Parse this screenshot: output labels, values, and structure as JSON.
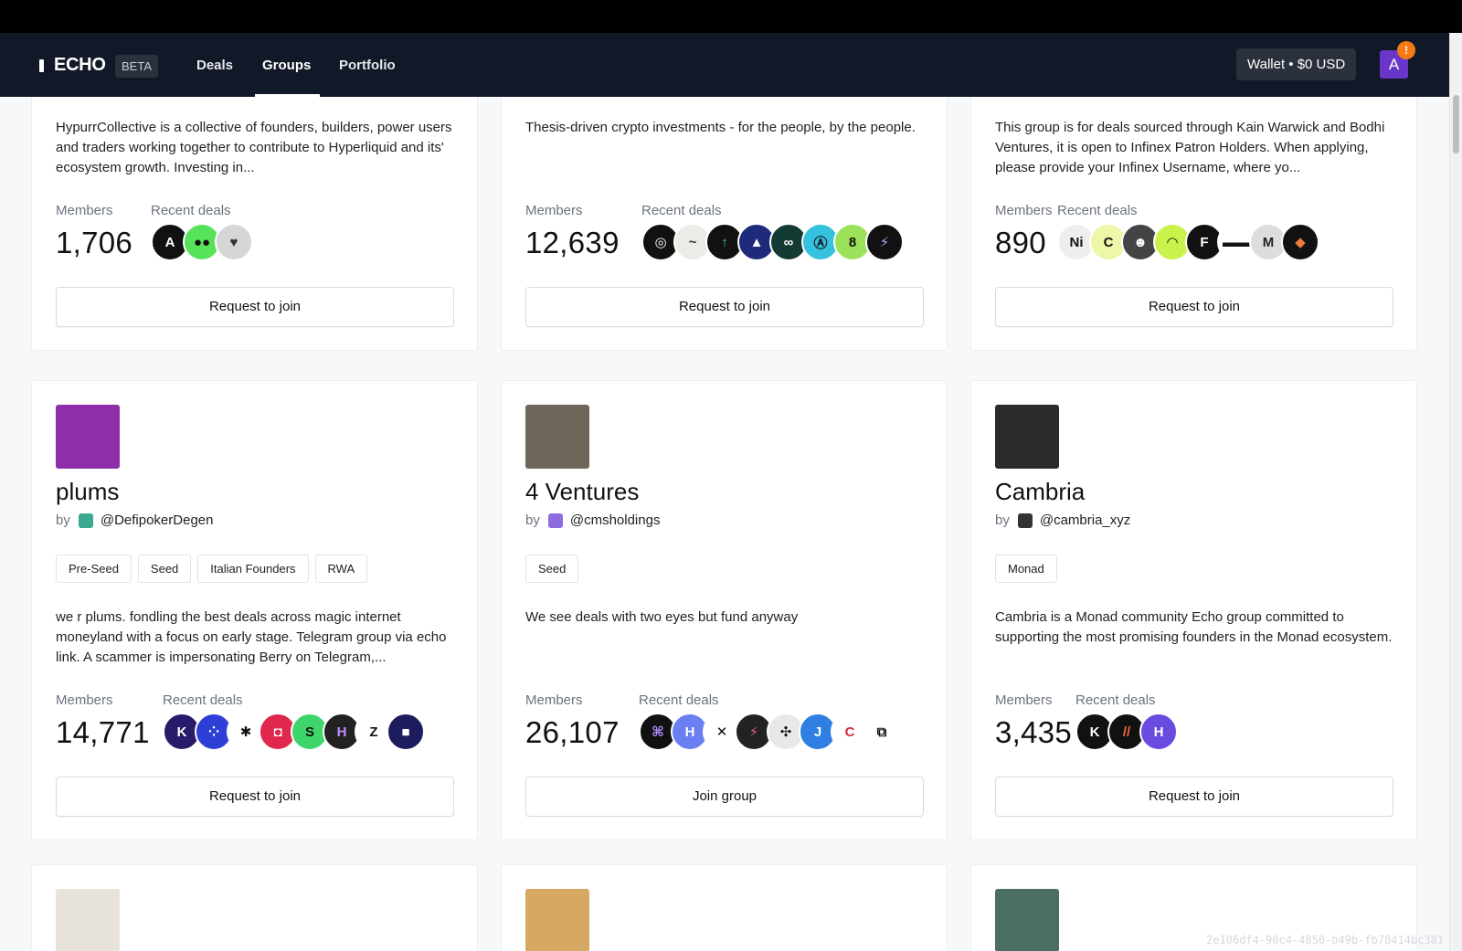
{
  "nav": {
    "logo": "ECHO",
    "beta": "BETA",
    "links": [
      "Deals",
      "Groups",
      "Portfolio"
    ],
    "active": "Groups",
    "wallet": "Wallet • $0 USD",
    "avatar_initial": "A",
    "notification": "!"
  },
  "labels": {
    "members": "Members",
    "recent_deals": "Recent deals",
    "by": "by"
  },
  "row1": [
    {
      "description": "HypurrCollective is a collective of founders, builders, power users and traders working together to contribute to Hyperliquid and its' ecosystem growth. Investing in...",
      "members": "1,706",
      "deals": [
        {
          "icon": "ai-logo",
          "bg": "#111111",
          "fg": "#ffffff",
          "glyph": "A"
        },
        {
          "icon": "eyes-logo",
          "bg": "#56e35a",
          "fg": "#111111",
          "glyph": "●●"
        },
        {
          "icon": "heart-pixel-logo",
          "bg": "#d6d6d6",
          "fg": "#333333",
          "glyph": "♥"
        }
      ],
      "button": "Request to join"
    },
    {
      "description": "Thesis-driven crypto investments - for the people, by the people.",
      "members": "12,639",
      "deals": [
        {
          "icon": "ring-logo",
          "bg": "#111111",
          "fg": "#ffffff",
          "glyph": "◎"
        },
        {
          "icon": "script-logo",
          "bg": "#ecebe6",
          "fg": "#333333",
          "glyph": "~"
        },
        {
          "icon": "arrow-up-logo",
          "bg": "#111111",
          "fg": "#3bdc7a",
          "glyph": "↑"
        },
        {
          "icon": "triangle-logo",
          "bg": "#1d2b7a",
          "fg": "#ffffff",
          "glyph": "▲"
        },
        {
          "icon": "infinity-logo",
          "bg": "#143a34",
          "fg": "#ffffff",
          "glyph": "∞"
        },
        {
          "icon": "circle-a-logo",
          "bg": "#35c2df",
          "fg": "#111111",
          "glyph": "Ⓐ"
        },
        {
          "icon": "eight-logo",
          "bg": "#9be25a",
          "fg": "#111111",
          "glyph": "8"
        },
        {
          "icon": "feather-logo",
          "bg": "#111111",
          "fg": "#9fa8ff",
          "glyph": "⚡"
        }
      ],
      "button": "Request to join"
    },
    {
      "description": "This group is for deals sourced through Kain Warwick and Bodhi Ventures, it is open to Infinex Patron Holders. When applying, please provide your Infinex Username, where yo...",
      "members": "890",
      "deals": [
        {
          "icon": "ni-logo",
          "bg": "#eeeeee",
          "fg": "#111111",
          "glyph": "Ni"
        },
        {
          "icon": "c-logo",
          "bg": "#eef7a8",
          "fg": "#111111",
          "glyph": "C"
        },
        {
          "icon": "creature-logo",
          "bg": "#444444",
          "fg": "#ffffff",
          "glyph": "☻"
        },
        {
          "icon": "waves-logo",
          "bg": "#c9f24a",
          "fg": "#111111",
          "glyph": "◠"
        },
        {
          "icon": "f-logo",
          "bg": "#111111",
          "fg": "#ffffff",
          "glyph": "F"
        },
        {
          "icon": "sunglasses-logo",
          "bg": "#ffffff",
          "fg": "#111111",
          "glyph": "▬▬"
        },
        {
          "icon": "m-logo",
          "bg": "#dddddd",
          "fg": "#222222",
          "glyph": "M"
        },
        {
          "icon": "peak-logo",
          "bg": "#111111",
          "fg": "#f07a3b",
          "glyph": "◆"
        }
      ],
      "button": "Request to join"
    }
  ],
  "row2": [
    {
      "name": "plums",
      "handle": "@DefipokerDegen",
      "avatar_color": "#8e2fa8",
      "mini_color": "#3aa98f",
      "tags": [
        "Pre-Seed",
        "Seed",
        "Italian Founders",
        "RWA"
      ],
      "description": "we r plums. fondling the best deals across magic internet moneyland with a focus on early stage. Telegram group via echo link. A scammer is impersonating Berry on Telegram,...",
      "members": "14,771",
      "deals": [
        {
          "icon": "kizzy-logo",
          "bg": "#2a1a6b",
          "fg": "#ffffff",
          "glyph": "K"
        },
        {
          "icon": "dots-logo",
          "bg": "#2d3fd6",
          "fg": "#ffffff",
          "glyph": "⁘"
        },
        {
          "icon": "asterisk-logo",
          "bg": "#ffffff",
          "fg": "#111111",
          "glyph": "✱"
        },
        {
          "icon": "pixel-logo",
          "bg": "#e0284f",
          "fg": "#ffffff",
          "glyph": "◘"
        },
        {
          "icon": "s-logo",
          "bg": "#3ed66b",
          "fg": "#111111",
          "glyph": "S"
        },
        {
          "icon": "hash-logo",
          "bg": "#222222",
          "fg": "#c08cff",
          "glyph": "H"
        },
        {
          "icon": "z-logo",
          "bg": "#ffffff",
          "fg": "#111111",
          "glyph": "Z"
        },
        {
          "icon": "square-logo",
          "bg": "#1c1c5e",
          "fg": "#ffffff",
          "glyph": "■"
        }
      ],
      "button": "Request to join"
    },
    {
      "name": "4 Ventures",
      "handle": "@cmsholdings",
      "avatar_color": "#6e6658",
      "mini_color": "#8e6be0",
      "tags": [
        "Seed"
      ],
      "description": "We see deals with two eyes but fund anyway",
      "members": "26,107",
      "deals": [
        {
          "icon": "command-logo",
          "bg": "#111111",
          "fg": "#b58cff",
          "glyph": "⌘"
        },
        {
          "icon": "h-logo",
          "bg": "#6b7ef2",
          "fg": "#ffffff",
          "glyph": "H"
        },
        {
          "icon": "knot-logo",
          "bg": "#ffffff",
          "fg": "#111111",
          "glyph": "✕"
        },
        {
          "icon": "bolt-logo",
          "bg": "#222222",
          "fg": "#e45a8f",
          "glyph": "⚡"
        },
        {
          "icon": "compass-logo",
          "bg": "#e8e8e8",
          "fg": "#111111",
          "glyph": "✣"
        },
        {
          "icon": "j-logo",
          "bg": "#2f7fe3",
          "fg": "#ffffff",
          "glyph": "J"
        },
        {
          "icon": "c-red-logo",
          "bg": "#ffffff",
          "fg": "#d8263a",
          "glyph": "C"
        },
        {
          "icon": "cube-logo",
          "bg": "#ffffff",
          "fg": "#111111",
          "glyph": "⧉"
        }
      ],
      "button": "Join group"
    },
    {
      "name": "Cambria",
      "handle": "@cambria_xyz",
      "avatar_color": "#2a2a2a",
      "mini_color": "#333333",
      "tags": [
        "Monad"
      ],
      "description": "Cambria is a Monad community Echo group committed to supporting the most promising founders in the Monad ecosystem.",
      "members": "3,435",
      "deals": [
        {
          "icon": "kinetic-logo",
          "bg": "#111111",
          "fg": "#ffffff",
          "glyph": "K"
        },
        {
          "icon": "stripes-logo",
          "bg": "#111111",
          "fg": "#f06a3a",
          "glyph": "//"
        },
        {
          "icon": "h-purple-logo",
          "bg": "#6a4be0",
          "fg": "#ffffff",
          "glyph": "H"
        }
      ],
      "button": "Request to join"
    }
  ],
  "row3": [
    {
      "avatar_color": "#e7e2dc"
    },
    {
      "avatar_color": "#d6a861"
    },
    {
      "avatar_color": "#4a6d64"
    }
  ],
  "watermark": "2e106df4-90c4-4850-b49b-fb78414bc381"
}
